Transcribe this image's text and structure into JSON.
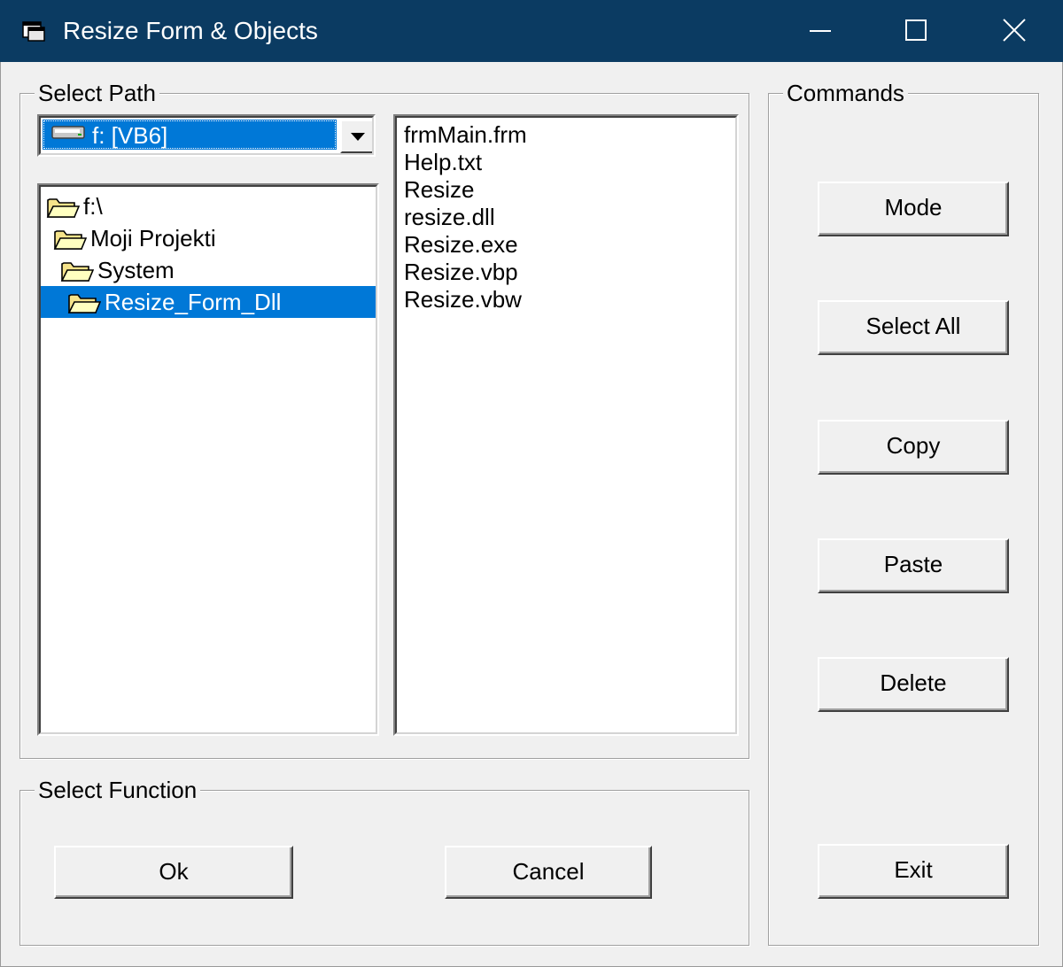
{
  "window": {
    "title": "Resize Form & Objects",
    "icon": "vb-form-icon"
  },
  "select_path": {
    "legend": "Select Path",
    "drive": {
      "selected": "f: [VB6]",
      "icon": "drive-icon"
    },
    "directories": [
      {
        "label": "f:\\",
        "selected": false,
        "icon": "open-folder-icon"
      },
      {
        "label": "Moji Projekti",
        "selected": false,
        "icon": "open-folder-icon"
      },
      {
        "label": "System",
        "selected": false,
        "icon": "open-folder-icon"
      },
      {
        "label": "Resize_Form_Dll",
        "selected": true,
        "icon": "open-folder-icon"
      }
    ],
    "files": [
      "frmMain.frm",
      "Help.txt",
      "Resize",
      "resize.dll",
      "Resize.exe",
      "Resize.vbp",
      "Resize.vbw"
    ]
  },
  "select_function": {
    "legend": "Select Function",
    "ok_label": "Ok",
    "cancel_label": "Cancel"
  },
  "commands": {
    "legend": "Commands",
    "mode_label": "Mode",
    "select_all_label": "Select All",
    "copy_label": "Copy",
    "paste_label": "Paste",
    "delete_label": "Delete",
    "exit_label": "Exit"
  },
  "colors": {
    "title_bar": "#0b3b62",
    "selection": "#0078d7",
    "face": "#f0f0f0"
  }
}
